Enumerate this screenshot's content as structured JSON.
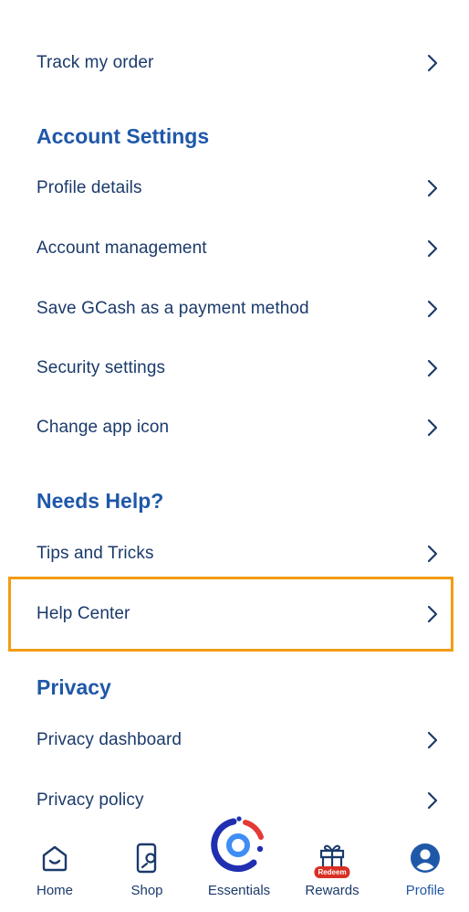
{
  "menu": {
    "track_order": "Track my order",
    "account_settings": {
      "heading": "Account Settings",
      "items": [
        {
          "label": "Profile details"
        },
        {
          "label": "Account management"
        },
        {
          "label": "Save GCash as a payment method"
        },
        {
          "label": "Security settings"
        },
        {
          "label": "Change app icon"
        }
      ]
    },
    "needs_help": {
      "heading": "Needs Help?",
      "items": [
        {
          "label": "Tips and Tricks"
        },
        {
          "label": "Help Center"
        }
      ]
    },
    "privacy": {
      "heading": "Privacy",
      "items": [
        {
          "label": "Privacy dashboard"
        },
        {
          "label": "Privacy policy"
        }
      ]
    }
  },
  "bottom_nav": {
    "items": [
      {
        "label": "Home",
        "icon": "home-icon"
      },
      {
        "label": "Shop",
        "icon": "shop-icon"
      },
      {
        "label": "Essentials",
        "icon": "essentials-icon"
      },
      {
        "label": "Rewards",
        "icon": "gift-icon",
        "badge": "Redeem"
      },
      {
        "label": "Profile",
        "icon": "profile-icon",
        "active": true
      }
    ]
  },
  "colors": {
    "text_primary": "#1b3a6b",
    "heading": "#1f58a8",
    "highlight": "#f39c12",
    "badge": "#d93025",
    "essentials_red": "#e53935"
  }
}
